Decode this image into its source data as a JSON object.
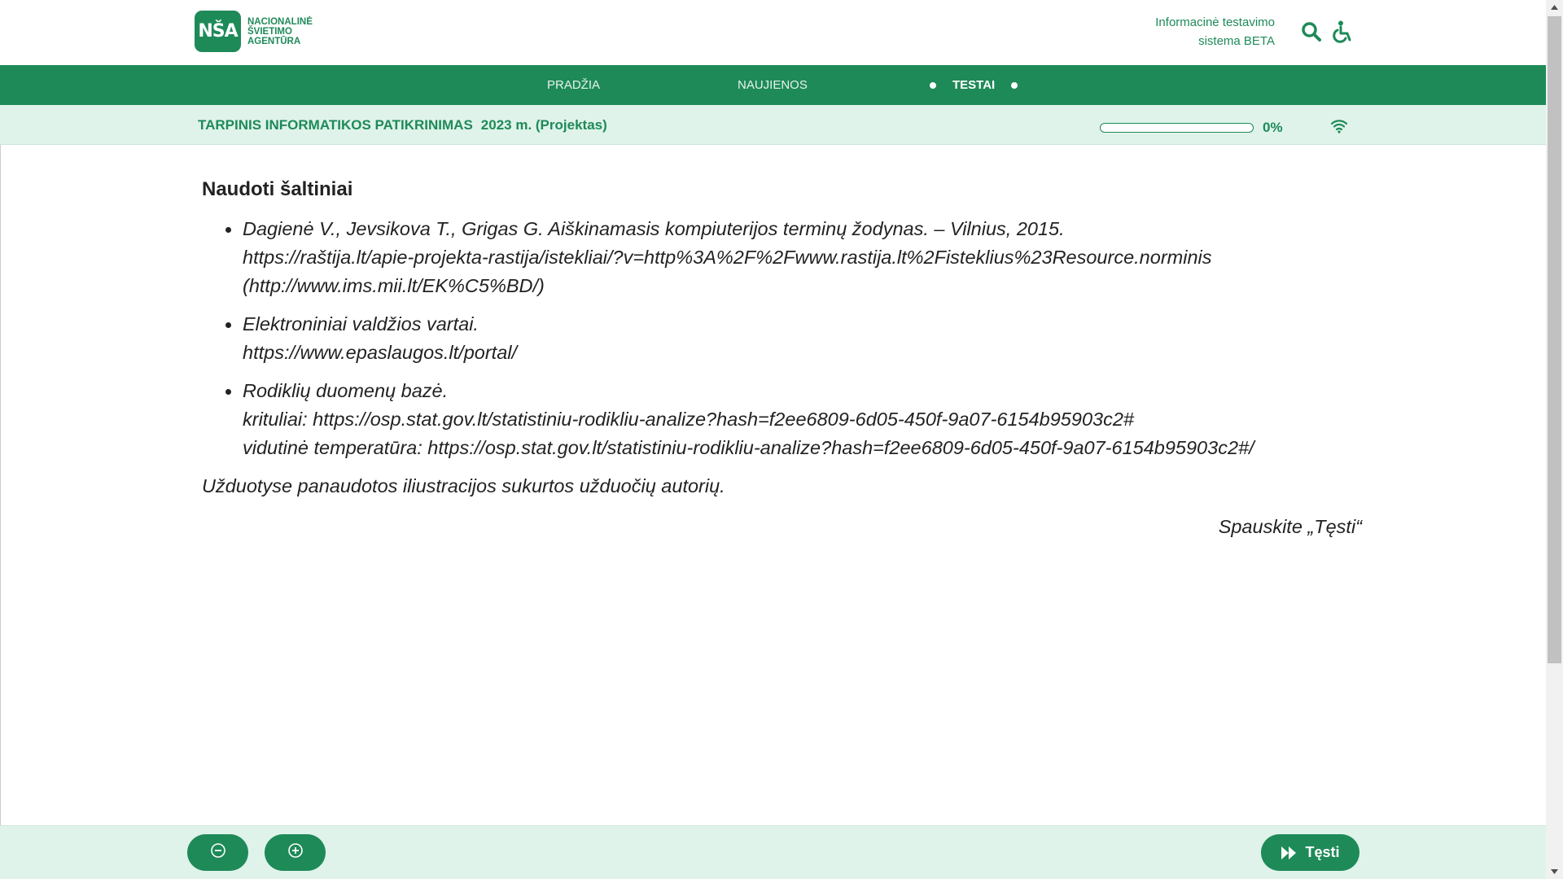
{
  "logo": {
    "mark": "NŠA",
    "lines": [
      "NACIONALINĖ",
      "ŠVIETIMO",
      "AGENTŪRA"
    ]
  },
  "header": {
    "system_line1": "Informacinė testavimo",
    "system_line2": "sistema BETA",
    "search_icon": "search-icon",
    "accessibility_icon": "wheelchair-icon"
  },
  "nav": {
    "items": [
      {
        "label": "PRADŽIA"
      },
      {
        "label": "NAUJIENOS"
      },
      {
        "label": "TESTAI",
        "active": true
      }
    ]
  },
  "test": {
    "title": "TARPINIS INFORMATIKOS PATIKRINIMAS",
    "year": "2023 m. (Projektas)",
    "progress_percent": 0,
    "progress_label": "0%",
    "connection_icon": "wifi-icon"
  },
  "content": {
    "section_title": "Naudoti šaltiniai",
    "sources": [
      {
        "lines": [
          "Dagienė V., Jevsikova T., Grigas G. Aiškinamasis kompiuterijos terminų žodynas. – Vilnius, 2015.",
          "https://raštija.lt/apie-projekta-rastija/istekliai/?v=http%3A%2F%2Fwww.rastija.lt%2Fisteklius%23Resource.norminis",
          "(http://www.ims.mii.lt/EK%C5%BD/)"
        ]
      },
      {
        "lines": [
          "Elektroniniai valdžios vartai.",
          "https://www.epaslaugos.lt/portal/"
        ]
      },
      {
        "lines": [
          "Rodiklių duomenų bazė.",
          "krituliai: https://osp.stat.gov.lt/statistiniu-rodikliu-analize?hash=f2ee6809-6d05-450f-9a07-6154b95903c2#",
          "vidutinė temperatūra: https://osp.stat.gov.lt/statistiniu-rodikliu-analize?hash=f2ee6809-6d05-450f-9a07-6154b95903c2#/"
        ]
      }
    ],
    "note": "Užduotyse panaudotos iliustracijos sukurtos užduočių autorių.",
    "continue_hint": "Spauskite „Tęsti“"
  },
  "footer": {
    "zoom_out_icon": "zoom-out-icon",
    "zoom_in_icon": "zoom-in-icon",
    "next_label": "Tęsti",
    "next_icon": "fast-forward-icon"
  },
  "colors": {
    "brand_green": "#1e8a58",
    "light_green": "#dff3ea"
  }
}
